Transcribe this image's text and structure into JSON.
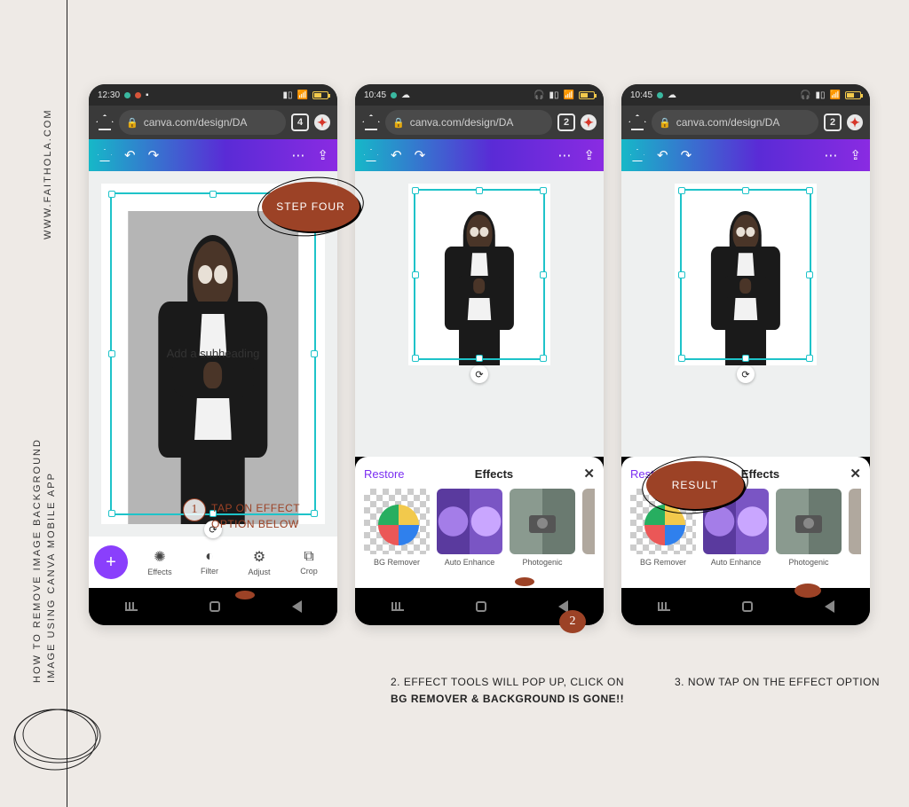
{
  "sidebar": {
    "url": "WWW.FAITHOLA.COM",
    "title_line1": "HOW  TO  REMOVE   IMAGE  BACKGROUND",
    "title_line2": "IMAGE USING CANVA MOBILE  APP"
  },
  "annotations": {
    "step_badge": "STEP FOUR",
    "result_badge": "RESULT",
    "num1": "1",
    "num2": "2",
    "tap_l1": "TAP ON EFFECT",
    "tap_l2": "OPTION BELOW"
  },
  "captions": {
    "c2_prefix": "2. EFFECT TOOLS WILL POP UP, CLICK ON",
    "c2_strong": "BG REMOVER & BACKGROUND IS GONE!!",
    "c3": "3. NOW TAP ON THE EFFECT OPTION"
  },
  "phone1": {
    "time": "12:30",
    "url": "canva.com/design/DA",
    "tabs": "4",
    "tools": {
      "effects": "Effects",
      "filter": "Filter",
      "adjust": "Adjust",
      "crop": "Crop"
    },
    "sub_text": "Add a subheading"
  },
  "phone2": {
    "time": "10:45",
    "url": "canva.com/design/DA",
    "tabs": "2",
    "effects": {
      "restore": "Restore",
      "title": "Effects",
      "bgremover": "BG Remover",
      "autoenhance": "Auto Enhance",
      "photogenic": "Photogenic"
    }
  },
  "phone3": {
    "time": "10:45",
    "url": "canva.com/design/DA",
    "tabs": "2",
    "effects": {
      "restore": "Restore",
      "title": "Effects",
      "bgremover": "BG Remover",
      "autoenhance": "Auto Enhance",
      "photogenic": "Photogenic"
    }
  }
}
